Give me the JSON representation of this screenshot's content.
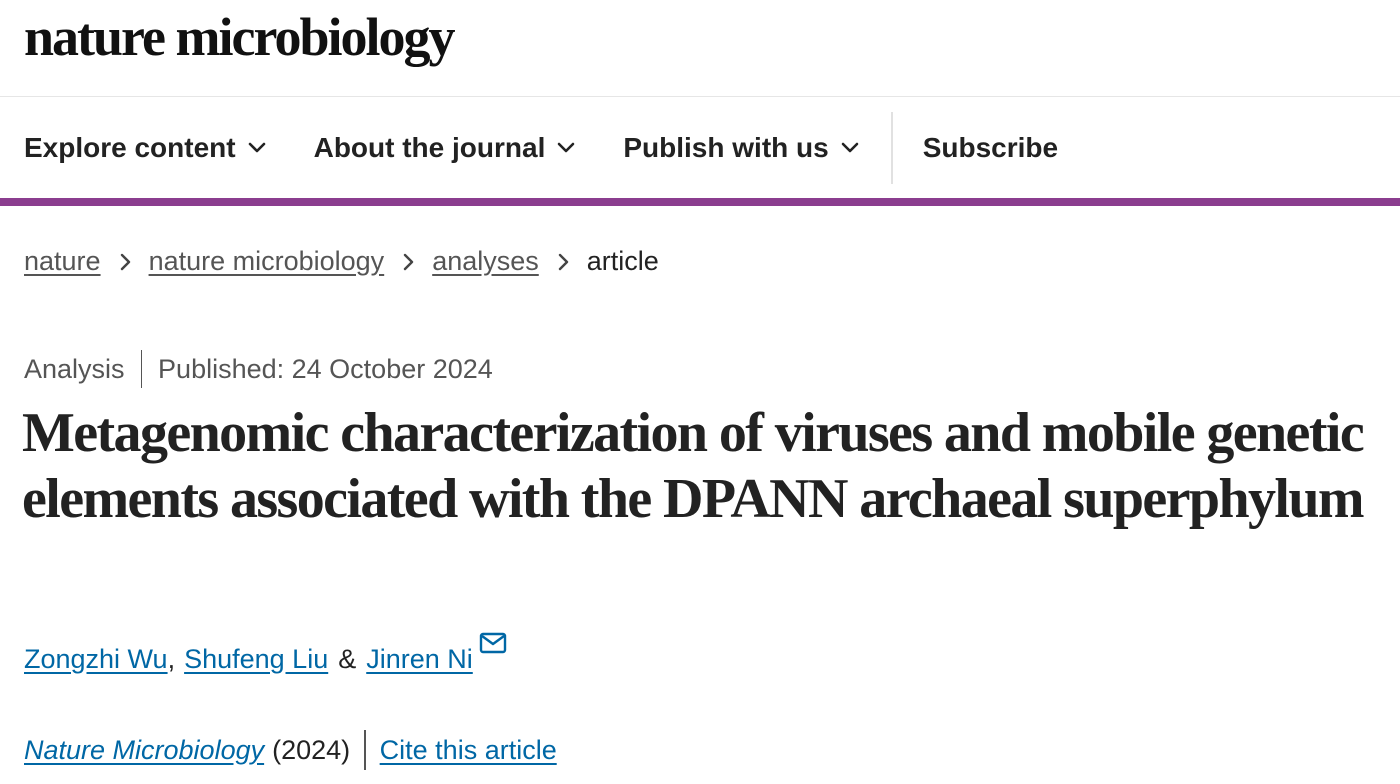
{
  "header": {
    "brand": "nature microbiology"
  },
  "nav": {
    "items": [
      {
        "label": "Explore content",
        "icon": "chevron-down-icon"
      },
      {
        "label": "About the journal",
        "icon": "chevron-down-icon"
      },
      {
        "label": "Publish with us",
        "icon": "chevron-down-icon"
      }
    ],
    "subscribe": "Subscribe",
    "accent_color": "#8b3d8f"
  },
  "breadcrumb": {
    "items": [
      "nature",
      "nature microbiology",
      "analyses"
    ],
    "current": "article",
    "separator_icon": "chevron-right-icon"
  },
  "article": {
    "type": "Analysis",
    "published": "Published: 24 October 2024",
    "title": "Metagenomic characterization of viruses and mobile genetic elements associated with the DPANN archaeal superphylum",
    "authors": [
      "Zongzhi Wu",
      "Shufeng Liu",
      "Jinren Ni"
    ],
    "author_sep": ",",
    "author_and": "&",
    "corresponding_icon": "mail-icon",
    "journal": "Nature Microbiology",
    "year": "(2024)",
    "cite": "Cite this article",
    "link_color": "#0067a5"
  }
}
